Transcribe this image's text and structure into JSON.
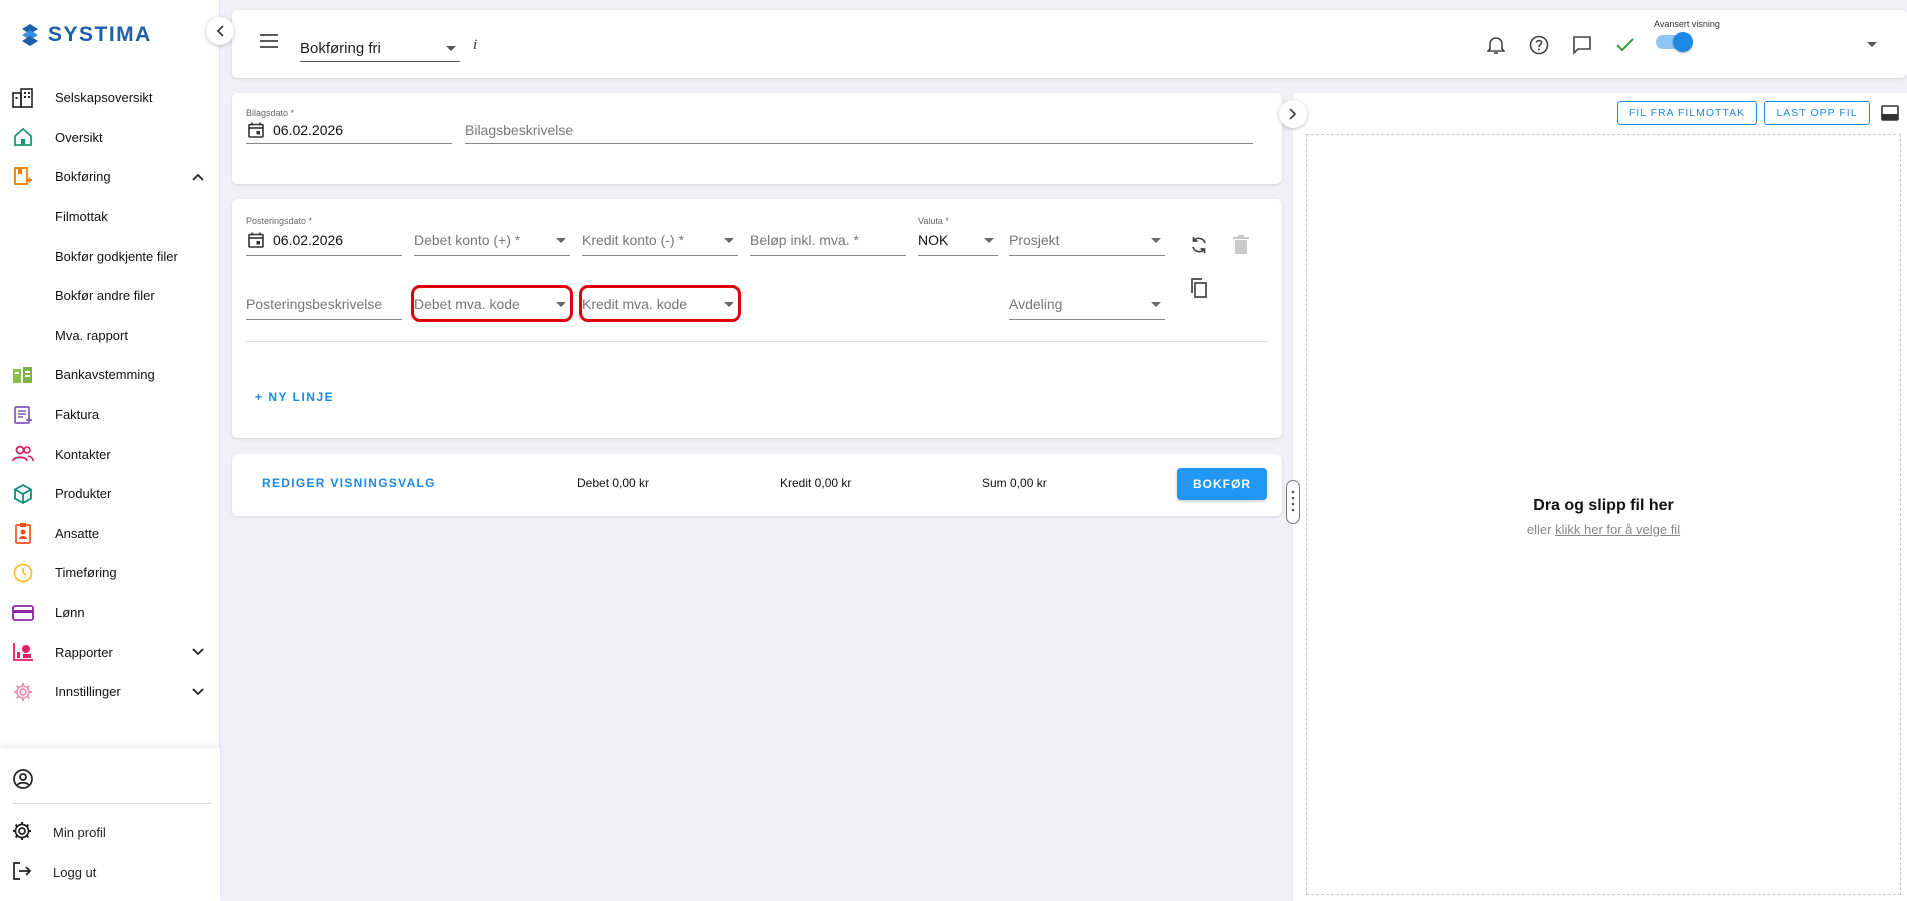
{
  "brand": {
    "name": "SYSTIMA",
    "color": "#1d5fa8"
  },
  "sidebar": {
    "items": [
      {
        "label": "Selskapsoversikt",
        "icon": "building-icon"
      },
      {
        "label": "Oversikt",
        "icon": "home-icon"
      },
      {
        "label": "Bokføring",
        "icon": "bookkeeping-icon",
        "expanded": true
      },
      {
        "label": "Filmottak"
      },
      {
        "label": "Bokfør godkjente filer"
      },
      {
        "label": "Bokfør andre filer"
      },
      {
        "label": "Mva. rapport"
      },
      {
        "label": "Bankavstemming",
        "icon": "bank-icon"
      },
      {
        "label": "Faktura",
        "icon": "invoice-icon"
      },
      {
        "label": "Kontakter",
        "icon": "contacts-icon"
      },
      {
        "label": "Produkter",
        "icon": "product-icon"
      },
      {
        "label": "Ansatte",
        "icon": "employee-icon"
      },
      {
        "label": "Timeføring",
        "icon": "clock-icon"
      },
      {
        "label": "Lønn",
        "icon": "payroll-icon"
      },
      {
        "label": "Rapporter",
        "icon": "reports-icon",
        "expanded": false
      },
      {
        "label": "Innstillinger",
        "icon": "settings-icon",
        "expanded": false
      }
    ],
    "bottom": {
      "profile": "Min profil",
      "logout": "Logg ut"
    }
  },
  "topbar": {
    "mode": "Bokføring fri",
    "info": "i",
    "advanced_label": "Avansert visning",
    "advanced_on": true
  },
  "voucher": {
    "date_label": "Bilagsdato *",
    "date_value": "06.02.2026",
    "description_placeholder": "Bilagsbeskrivelse"
  },
  "posting": {
    "date_label": "Posteringsdato *",
    "date_value": "06.02.2026",
    "debit_account": "Debet konto (+) *",
    "credit_account": "Kredit konto (-) *",
    "amount": "Beløp inkl. mva. *",
    "currency_label": "Valuta *",
    "currency_value": "NOK",
    "project": "Prosjekt",
    "description": "Posteringsbeskrivelse",
    "debit_vat": "Debet mva. kode",
    "credit_vat": "Kredit mva. kode",
    "department": "Avdeling",
    "new_line": "+ NY LINJE"
  },
  "summary": {
    "edit_view": "REDIGER VISNINGSVALG",
    "debit": "Debet 0,00 kr",
    "credit": "Kredit 0,00 kr",
    "sum": "Sum 0,00 kr",
    "book": "BOKFØR"
  },
  "file_panel": {
    "from_inbox": "FIL FRA FILMOTTAK",
    "upload": "LAST OPP FIL",
    "drop_title": "Dra og slipp fil her",
    "drop_or": "eller",
    "drop_link": "klikk her for å velge fil"
  },
  "colors": {
    "accent": "#1e88e5",
    "highlight": "#e0000a",
    "success": "#2e9e3a"
  }
}
